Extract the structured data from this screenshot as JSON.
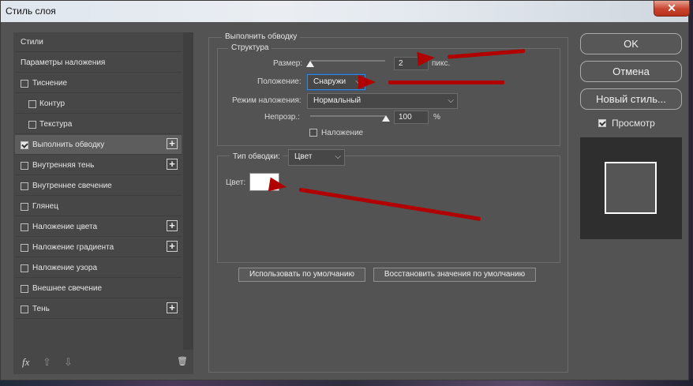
{
  "window": {
    "title": "Стиль слоя",
    "close_label": "✕"
  },
  "sidebar": {
    "items": [
      {
        "label": "Стили",
        "checkbox": false,
        "checked": false,
        "plus": false,
        "indent": false
      },
      {
        "label": "Параметры наложения",
        "checkbox": false,
        "checked": false,
        "plus": false,
        "indent": false
      },
      {
        "label": "Тиснение",
        "checkbox": true,
        "checked": false,
        "plus": false,
        "indent": false
      },
      {
        "label": "Контур",
        "checkbox": true,
        "checked": false,
        "plus": false,
        "indent": true
      },
      {
        "label": "Текстура",
        "checkbox": true,
        "checked": false,
        "plus": false,
        "indent": true
      },
      {
        "label": "Выполнить обводку",
        "checkbox": true,
        "checked": true,
        "plus": true,
        "indent": false,
        "active": true
      },
      {
        "label": "Внутренняя тень",
        "checkbox": true,
        "checked": false,
        "plus": true,
        "indent": false
      },
      {
        "label": "Внутреннее свечение",
        "checkbox": true,
        "checked": false,
        "plus": false,
        "indent": false
      },
      {
        "label": "Глянец",
        "checkbox": true,
        "checked": false,
        "plus": false,
        "indent": false
      },
      {
        "label": "Наложение цвета",
        "checkbox": true,
        "checked": false,
        "plus": true,
        "indent": false
      },
      {
        "label": "Наложение градиента",
        "checkbox": true,
        "checked": false,
        "plus": true,
        "indent": false
      },
      {
        "label": "Наложение узора",
        "checkbox": true,
        "checked": false,
        "plus": false,
        "indent": false
      },
      {
        "label": "Внешнее свечение",
        "checkbox": true,
        "checked": false,
        "plus": false,
        "indent": false
      },
      {
        "label": "Тень",
        "checkbox": true,
        "checked": false,
        "plus": true,
        "indent": false
      }
    ],
    "bottom_icons": {
      "fx": "fx",
      "up": "⇧",
      "down": "⇩",
      "trash": "🗑"
    }
  },
  "stroke": {
    "group_title": "Выполнить обводку",
    "structure_title": "Структура",
    "size_label": "Размер:",
    "size_value": "2",
    "size_unit": "пикс.",
    "position_label": "Положение:",
    "position_value": "Снаружи",
    "blend_label": "Режим наложения:",
    "blend_value": "Нормальный",
    "opacity_label": "Непрозр.:",
    "opacity_value": "100",
    "opacity_unit": "%",
    "overprint_label": "Наложение",
    "fill_type_label": "Тип обводки:",
    "fill_type_value": "Цвет",
    "color_label": "Цвет:",
    "color_value": "#ffffff",
    "default_button": "Использовать по умолчанию",
    "reset_button": "Восстановить значения по умолчанию"
  },
  "buttons": {
    "ok": "OK",
    "cancel": "Отмена",
    "new_style": "Новый стиль...",
    "preview_label": "Просмотр",
    "preview_checked": true
  },
  "colors": {
    "annotation_arrow": "#b00000",
    "panel_bg": "#535353"
  }
}
